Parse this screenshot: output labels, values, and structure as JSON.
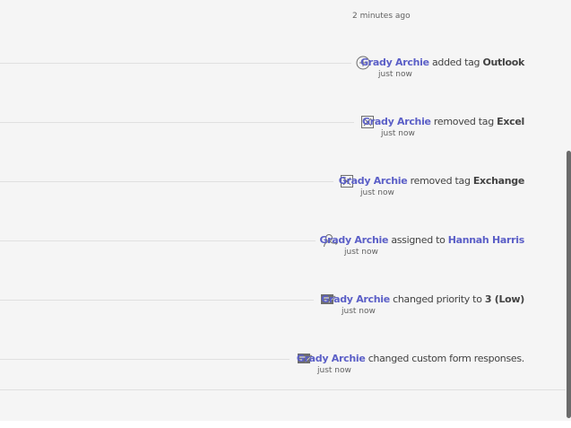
{
  "header": {
    "timestamp": "2 minutes ago"
  },
  "activity": [
    {
      "icon": "add-circle-icon",
      "user": "Grady Archie",
      "action": "added tag",
      "target": "Outlook",
      "time": "just now"
    },
    {
      "icon": "remove-box-icon",
      "user": "Grady Archie",
      "action": "removed tag",
      "target": "Excel",
      "time": "just now"
    },
    {
      "icon": "remove-box-icon",
      "user": "Grady Archie",
      "action": "removed tag",
      "target": "Exchange",
      "time": "just now"
    },
    {
      "icon": "person-icon",
      "user": "Grady Archie",
      "action": "assigned to",
      "target": "Hannah Harris",
      "time": "just now"
    },
    {
      "icon": "edit-form-icon",
      "user": "Grady Archie",
      "action": "changed priority to",
      "target": "3 (Low)",
      "time": "just now"
    },
    {
      "icon": "edit-form-icon",
      "user": "Grady Archie",
      "action": "changed custom form responses.",
      "target": "",
      "time": "just now"
    }
  ]
}
